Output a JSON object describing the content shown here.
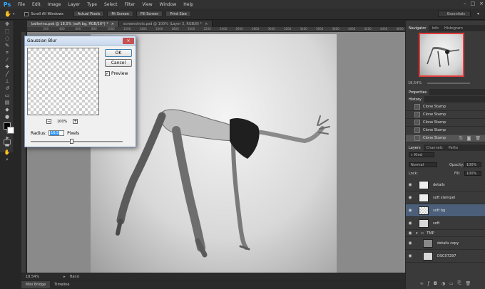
{
  "app": {
    "logo": "Ps",
    "menu": [
      "File",
      "Edit",
      "Image",
      "Layer",
      "Type",
      "Select",
      "Filter",
      "View",
      "Window",
      "Help"
    ],
    "window_controls": [
      "–",
      "□",
      "×"
    ]
  },
  "options_bar": {
    "scroll_all_label": "Scroll All Windows",
    "buttons": [
      "Actual Pixels",
      "Fit Screen",
      "Fill Screen",
      "Print Size"
    ],
    "workspace": "Essentials"
  },
  "tabs": [
    {
      "label": "ballerina.psd @ 18,5% (soft bg, RGB/16*) *",
      "close": "×",
      "active": true
    },
    {
      "label": "screenshots.psd @ 100% (Layer 3, RGB/8) *",
      "close": "×",
      "active": false
    }
  ],
  "ruler_ticks": [
    "",
    "200",
    "400",
    "600",
    "800",
    "1000",
    "1200",
    "1400",
    "1600",
    "1800",
    "2000",
    "2200",
    "2400",
    "2600",
    "2800",
    "3000",
    "3200",
    "3400",
    "3600",
    "3800",
    "4000",
    "4200",
    "4400",
    "4600"
  ],
  "status": {
    "zoom": "18,54%",
    "tool_name": "Hand"
  },
  "bottom_tabs": [
    "Mini Bridge",
    "Timeline"
  ],
  "navigator": {
    "tabs": [
      "Navigator",
      "Info",
      "Histogram"
    ],
    "zoom": "18,54%"
  },
  "properties": {
    "tab": "Properties"
  },
  "history": {
    "tab": "History",
    "items": [
      "Clone Stamp",
      "Clone Stamp",
      "Clone Stamp",
      "Clone Stamp",
      "Clone Stamp"
    ]
  },
  "layers": {
    "tabs": [
      "Layers",
      "Channels",
      "Paths"
    ],
    "kind_label": "Kind",
    "blend_mode": "Normal",
    "opacity_label": "Opacity:",
    "opacity_value": "100%",
    "lock_label": "Lock:",
    "fill_label": "Fill:",
    "fill_value": "100%",
    "items": [
      {
        "name": "details",
        "thumb": "white",
        "active": false
      },
      {
        "name": "soft stempel",
        "thumb": "white",
        "active": false
      },
      {
        "name": "soft bg",
        "thumb": "checker",
        "active": true
      },
      {
        "name": "soft",
        "thumb": "photo",
        "active": false
      },
      {
        "name": "TMP",
        "thumb": "group",
        "active": false
      },
      {
        "name": "details copy",
        "thumb": "grey",
        "active": false
      },
      {
        "name": "DSC07297",
        "thumb": "photo",
        "active": false
      }
    ]
  },
  "dialog": {
    "title": "Gaussian Blur",
    "close": "×",
    "ok": "OK",
    "cancel": "Cancel",
    "preview_label": "Preview",
    "preview_checked": true,
    "zoom_minus": "−",
    "zoom_plus": "+",
    "zoom_value": "100%",
    "radius_label": "Radius:",
    "radius_value": "16,5",
    "radius_unit": "Pixels"
  }
}
